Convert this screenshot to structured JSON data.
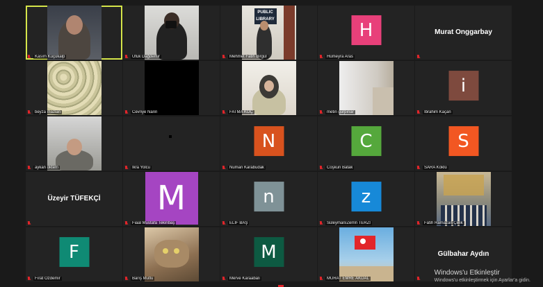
{
  "participants": [
    {
      "name": "Kasım Küçükalp",
      "type": "video",
      "scene": "kasim",
      "muted": true,
      "active": true
    },
    {
      "name": "Ufuk Dağdemir",
      "type": "video",
      "scene": "ufuk",
      "muted": true
    },
    {
      "name": "Mehmet Fatih Birgül",
      "type": "video",
      "scene": "library",
      "muted": true,
      "sign_text": "PUBLIC LIBRARY"
    },
    {
      "name": "Hümeyra Aras",
      "type": "avatar",
      "letter": "H",
      "color": "#e8407a",
      "muted": true
    },
    {
      "name": "Murat Onggarbay",
      "type": "namecard",
      "muted": true
    },
    {
      "name": "beyza mazlan",
      "type": "video",
      "scene": "wall",
      "muted": true
    },
    {
      "name": "Cevriye Narin",
      "type": "video",
      "scene": "black",
      "muted": true
    },
    {
      "name": "FATMA KOÇ",
      "type": "video",
      "scene": "fatma",
      "muted": true
    },
    {
      "name": "metin gürpınar",
      "type": "video",
      "scene": "metin",
      "muted": true
    },
    {
      "name": "İbrahim Kaçan",
      "type": "avatar",
      "letter": "i",
      "color": "#7e4a3e",
      "muted": true
    },
    {
      "name": "aykan oktem",
      "type": "video",
      "scene": "aykan",
      "muted": true
    },
    {
      "name": "İkra Yolcu",
      "type": "video",
      "scene": "empty",
      "muted": true
    },
    {
      "name": "Numan Karabudak",
      "type": "avatar",
      "letter": "N",
      "color": "#d8521e",
      "muted": true
    },
    {
      "name": "Coşkun Batak",
      "type": "avatar",
      "letter": "C",
      "color": "#55a83c",
      "muted": true
    },
    {
      "name": "SARA Köklü",
      "type": "avatar",
      "letter": "S",
      "color": "#f25722",
      "muted": true
    },
    {
      "name": "Üzeyir TÜFEKÇİ",
      "type": "namecard",
      "muted": true
    },
    {
      "name": "Fiaal Mustafa Tekinbaş",
      "type": "avatar-big",
      "letter": "M",
      "color": "#a545c2",
      "muted": true
    },
    {
      "name": "ELİF BAŞ",
      "type": "avatar",
      "letter": "n",
      "color": "#7f9297",
      "muted": true
    },
    {
      "name": "Süleyman/Zerrin TERZİ",
      "type": "avatar",
      "letter": "z",
      "color": "#1789d8",
      "muted": true
    },
    {
      "name": "Fatih Ramazan Çelik",
      "type": "video",
      "scene": "mosque",
      "muted": true
    },
    {
      "name": "Fırat Özdemir",
      "type": "avatar",
      "letter": "F",
      "color": "#0f8a74",
      "muted": true
    },
    {
      "name": "Barış Mutlu",
      "type": "video",
      "scene": "cat",
      "muted": true
    },
    {
      "name": "Merve Karaabalı",
      "type": "avatar",
      "letter": "M",
      "color": "#0d5a42",
      "muted": true
    },
    {
      "name": "MURAT EMRE AKDAL",
      "type": "video",
      "scene": "flag",
      "muted": true
    },
    {
      "name": "Gülbahar Aydın",
      "type": "namecard",
      "muted": true
    }
  ],
  "watermark": {
    "line1": "Windows'u Etkinleştir",
    "line2": "Windows'u etkinleştirmek için Ayarlar'a gidin."
  },
  "colors": {
    "active_border": "#d6e64a",
    "mute_icon": "#e0252a"
  }
}
